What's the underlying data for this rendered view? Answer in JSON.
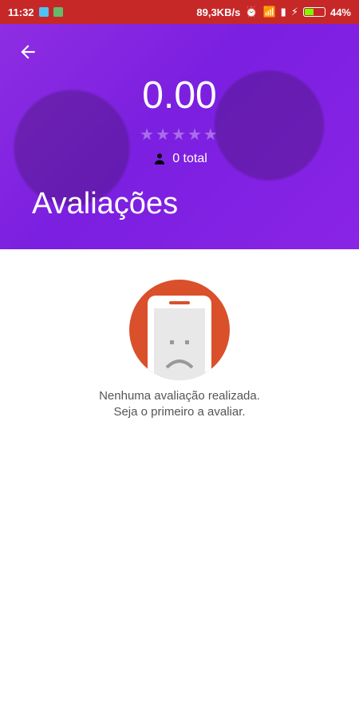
{
  "statusbar": {
    "time": "11:32",
    "speed": "89,3KB/s",
    "battery": "44%",
    "battery_level": 0.44
  },
  "header": {
    "rating": "0.00",
    "stars": "★★★★★",
    "total": "0 total",
    "title": "Avaliações",
    "accent": "#8e2de2"
  },
  "empty": {
    "line1": "Nenhuma avaliação realizada.",
    "line2": "Seja o primeiro a avaliar."
  }
}
